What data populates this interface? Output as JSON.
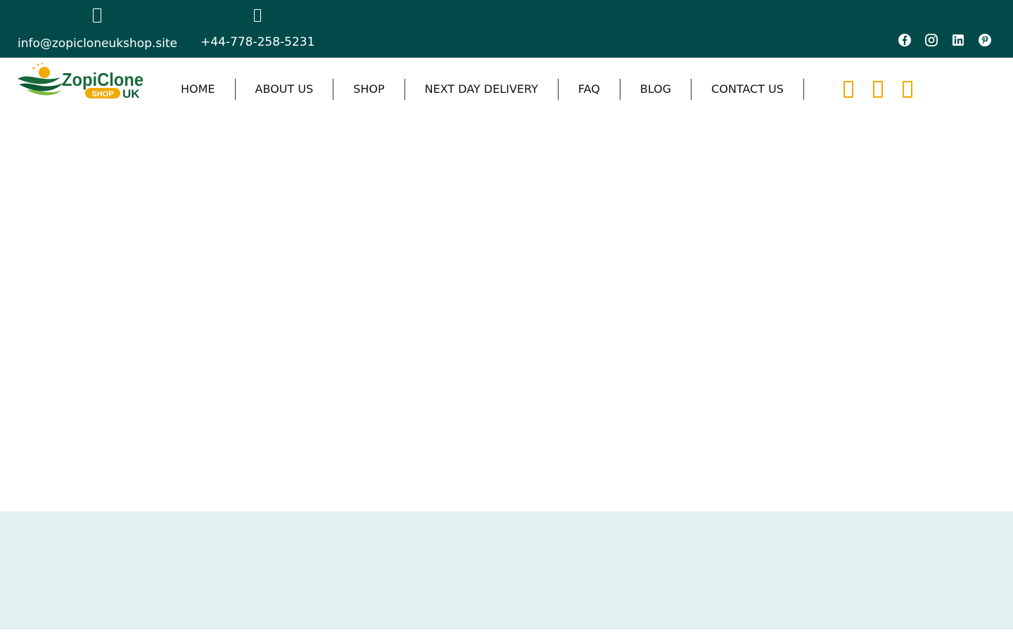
{
  "topbar": {
    "email": {
      "icon": "envelope-icon",
      "text": "info@zopicloneukshop.site"
    },
    "phone": {
      "icon": "phone-icon",
      "text": "+44-778-258-5231"
    },
    "social": [
      {
        "name": "facebook",
        "icon": "facebook-icon"
      },
      {
        "name": "instagram",
        "icon": "instagram-icon"
      },
      {
        "name": "linkedin",
        "icon": "linkedin-icon"
      },
      {
        "name": "pinterest",
        "icon": "pinterest-icon"
      }
    ]
  },
  "header": {
    "logo": {
      "text": "ZopiClone",
      "badge": "SHOP",
      "suffix": "UK"
    },
    "nav": [
      "HOME",
      "ABOUT US",
      "SHOP",
      "NEXT DAY DELIVERY",
      "FAQ",
      "BLOG",
      "CONTACT US"
    ],
    "actions": [
      {
        "name": "search",
        "icon": "search-icon"
      },
      {
        "name": "account",
        "icon": "user-icon"
      },
      {
        "name": "cart",
        "icon": "cart-icon"
      }
    ]
  },
  "colors": {
    "topbar_bg": "#024a4a",
    "accent": "#f2a900",
    "brand_green": "#1f6b3a",
    "band_bg": "#e2f1f1"
  }
}
